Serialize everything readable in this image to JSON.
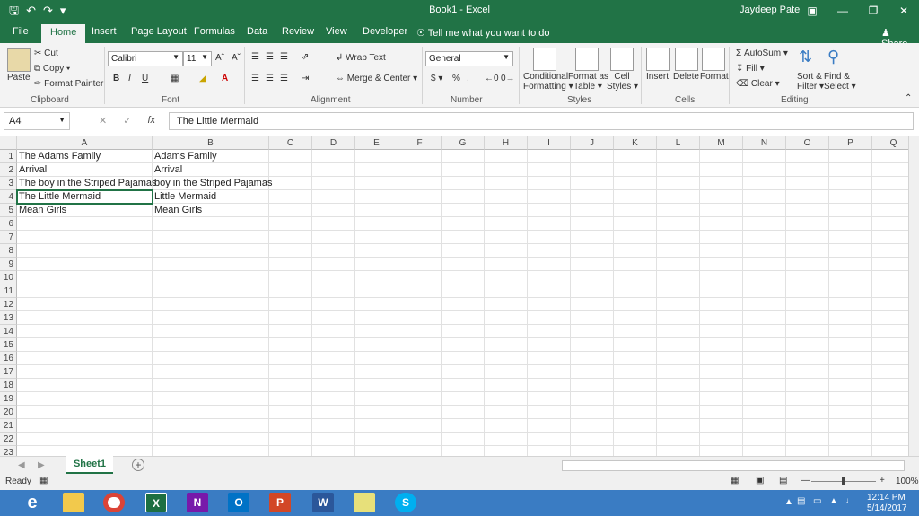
{
  "window": {
    "title": "Book1  -  Excel",
    "user": "Jaydeep Patel"
  },
  "tabs": [
    "File",
    "Home",
    "Insert",
    "Page Layout",
    "Formulas",
    "Data",
    "Review",
    "View",
    "Developer"
  ],
  "tell_me": "Tell me what you want to do",
  "share": "Share",
  "ribbon": {
    "clipboard": {
      "paste": "Paste",
      "cut": "Cut",
      "copy": "Copy",
      "format_painter": "Format Painter",
      "label": "Clipboard"
    },
    "font": {
      "name": "Calibri",
      "size": "11",
      "label": "Font"
    },
    "alignment": {
      "wrap": "Wrap Text",
      "merge": "Merge & Center",
      "label": "Alignment"
    },
    "number": {
      "format": "General",
      "label": "Number"
    },
    "styles": {
      "conditional1": "Conditional",
      "conditional2": "Formatting",
      "format_as1": "Format as",
      "format_as2": "Table",
      "cell1": "Cell",
      "cell2": "Styles",
      "label": "Styles"
    },
    "cells": {
      "insert": "Insert",
      "delete": "Delete",
      "format": "Format",
      "label": "Cells"
    },
    "editing": {
      "autosum": "AutoSum",
      "fill": "Fill",
      "clear": "Clear",
      "sort1": "Sort &",
      "sort2": "Filter",
      "find1": "Find &",
      "find2": "Select",
      "label": "Editing"
    }
  },
  "formula_bar": {
    "name_box": "A4",
    "formula": "The Little Mermaid"
  },
  "columns": [
    "A",
    "B",
    "C",
    "D",
    "E",
    "F",
    "G",
    "H",
    "I",
    "J",
    "K",
    "L",
    "M",
    "N",
    "O",
    "P",
    "Q"
  ],
  "rows": [
    "1",
    "2",
    "3",
    "4",
    "5",
    "6",
    "7",
    "8",
    "9",
    "10",
    "11",
    "12",
    "13",
    "14",
    "15",
    "16",
    "17",
    "18",
    "19",
    "20",
    "21",
    "22",
    "23"
  ],
  "cells": {
    "A": [
      "The Adams Family",
      "Arrival",
      "The boy in the Striped Pajamas",
      "The Little Mermaid",
      "Mean Girls"
    ],
    "B": [
      "Adams Family",
      "Arrival",
      "boy in the Striped Pajamas",
      "Little Mermaid",
      "Mean Girls"
    ]
  },
  "sheet_tab": "Sheet1",
  "status": {
    "ready": "Ready",
    "zoom": "100%"
  },
  "clock": {
    "time": "12:14 PM",
    "date": "5/14/2017"
  },
  "colors": {
    "excel_green": "#217346",
    "taskbar_blue": "#3a7cc3"
  }
}
